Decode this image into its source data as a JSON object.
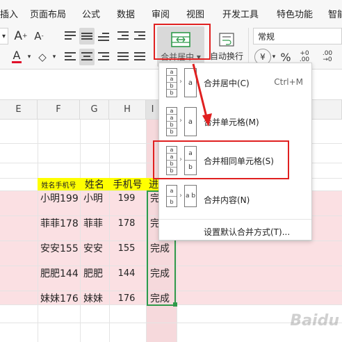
{
  "tabs": [
    "插入",
    "页面布局",
    "公式",
    "数据",
    "审阅",
    "视图",
    "开发工具",
    "特色功能",
    "智能"
  ],
  "toolbar": {
    "font_grow": "A",
    "font_shrink": "A",
    "font_color": "A",
    "merge_label": "合并居中",
    "auto_wrap": "自动换行",
    "number_format": "常规",
    "currency": "¥",
    "percent": "%",
    "inc_decimal": "+0 .00",
    "dec_decimal": ".00 →0"
  },
  "columns": [
    "E",
    "F",
    "G",
    "H",
    "I"
  ],
  "header_row": {
    "name_phone": "姓名手机号",
    "name": "姓名",
    "phone": "手机号",
    "status": "进"
  },
  "rows": [
    {
      "name_phone": "小明199",
      "name": "小明",
      "phone": "199",
      "status": "完"
    },
    {
      "name_phone": "菲菲178",
      "name": "菲菲",
      "phone": "178",
      "status": "完"
    },
    {
      "name_phone": "安安155",
      "name": "安安",
      "phone": "155",
      "status": "完成"
    },
    {
      "name_phone": "肥肥144",
      "name": "肥肥",
      "phone": "144",
      "status": "完成"
    },
    {
      "name_phone": "妹妹176",
      "name": "妹妹",
      "phone": "176",
      "status": "完成"
    }
  ],
  "menu": {
    "items": [
      {
        "label": "合并居中(C)",
        "shortcut": "Ctrl+M",
        "icon_right": "a"
      },
      {
        "label": "合并单元格(M)",
        "shortcut": "",
        "icon_right": "a"
      },
      {
        "label": "合并相同单元格(S)",
        "shortcut": "",
        "icon_right": "a b"
      },
      {
        "label": "合并内容(N)",
        "shortcut": "",
        "icon_right": "a b"
      }
    ],
    "footer": "设置默认合并方式(T)..."
  },
  "mini_icon_left": [
    "a",
    "a",
    "b",
    "b"
  ],
  "watermark": "Baidu"
}
